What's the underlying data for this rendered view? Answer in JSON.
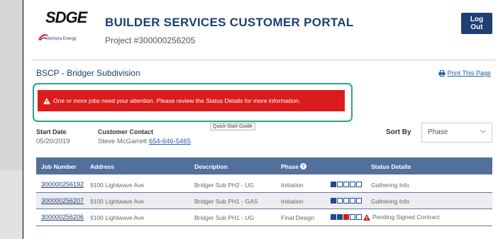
{
  "header": {
    "logo_text": "SDGE",
    "logo_subtext": "Sempra Energy",
    "title": "BUILDER SERVICES CUSTOMER PORTAL",
    "project": "Project #300000256205",
    "logout_label": "Log Out"
  },
  "subdivision": {
    "name": "BSCP - Bridger Subdivision",
    "print_label": "Print This Page"
  },
  "alert": {
    "message": "One or more jobs need your attention. Please review the Status Details for more information.",
    "tooltip": "Quick-Start Guide"
  },
  "info": {
    "start_date_label": "Start Date",
    "start_date": "05/20/2019",
    "contact_label": "Customer Contact",
    "contact_name": "Steve McGarrett",
    "contact_phone": "654-646-5465",
    "sort_label": "Sort By",
    "sort_value": "Phase"
  },
  "table": {
    "headers": [
      "Job Number",
      "Address",
      "Description",
      "Phase",
      "Status Details"
    ],
    "rows": [
      {
        "job": "300000256192",
        "address": "9100 Lightwave Ave",
        "description": "Bridger Sub PH2 - UG",
        "phase": "Initiation",
        "progress": [
          1,
          0,
          0,
          0,
          0
        ],
        "warn": false,
        "status": "Gathering Info"
      },
      {
        "job": "300000256207",
        "address": "9100 Lightwave Ave",
        "description": "Bridger Sub PH1 - GAS",
        "phase": "Initiation",
        "progress": [
          1,
          0,
          0,
          0,
          0
        ],
        "warn": false,
        "status": "Gathering Info"
      },
      {
        "job": "300000256206",
        "address": "9100 Lightwave Ave",
        "description": "Bridger Sub PH1 - UG",
        "phase": "Final Design",
        "progress": [
          1,
          1,
          2,
          0,
          0
        ],
        "warn": true,
        "status": "Pending Signed Contract"
      }
    ]
  },
  "colors": {
    "brand_blue": "#1d3f73",
    "alert_red": "#da1c1c",
    "table_header": "#52709b",
    "highlight_green": "#2aa38c"
  }
}
